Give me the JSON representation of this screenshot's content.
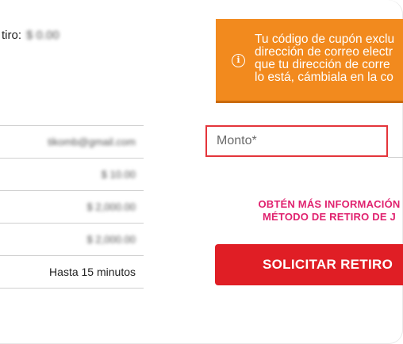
{
  "withdraw_label": "tiro:",
  "withdraw_value_blurred": "$ 0.00",
  "details": {
    "rows": [
      {
        "value": "tikomb@gmail.com",
        "blurred": true
      },
      {
        "value": "$ 10.00",
        "blurred": true
      },
      {
        "value": "$ 2,000.00",
        "blurred": true
      },
      {
        "value": "$ 2,000.00",
        "blurred": true
      },
      {
        "value": "Hasta 15 minutos",
        "blurred": false
      }
    ]
  },
  "notice": {
    "icon": "info-icon",
    "lines": [
      "Tu código de cupón exclu",
      "dirección de correo electr",
      "que tu dirección de corre",
      "lo está, cámbiala en la co"
    ],
    "background": "#f28a1e"
  },
  "amount_field": {
    "placeholder": "Monto*",
    "value": ""
  },
  "more_info": {
    "lines": [
      "OBTÉN MÁS INFORMACIÓN",
      "MÉTODO DE RETIRO DE J"
    ],
    "color": "#e0226f"
  },
  "submit_button": {
    "label": "SOLICITAR RETIRO",
    "color": "#e01e25"
  }
}
